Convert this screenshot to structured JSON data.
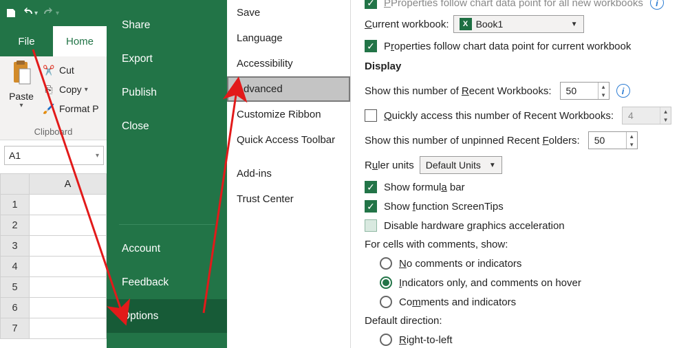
{
  "titlebar": {
    "undo_icon": "undo",
    "redo_icon": "redo",
    "save_icon": "save"
  },
  "tabs": {
    "file": "File",
    "home": "Home"
  },
  "ribbon": {
    "paste": "Paste",
    "cut": "Cut",
    "copy": "Copy",
    "format_painter": "Format P",
    "group_caption": "Clipboard"
  },
  "namebox": {
    "value": "A1"
  },
  "sheet": {
    "colA": "A",
    "rows": [
      "1",
      "2",
      "3",
      "4",
      "5",
      "6",
      "7"
    ]
  },
  "backstage": {
    "share": "Share",
    "export": "Export",
    "publish": "Publish",
    "close": "Close",
    "account": "Account",
    "feedback": "Feedback",
    "options": "Options"
  },
  "optnav": {
    "save": "Save",
    "language": "Language",
    "accessibility": "Accessibility",
    "advanced": "Advanced",
    "customize_ribbon": "Customize Ribbon",
    "quick_access": "Quick Access Toolbar",
    "addins": "Add-ins",
    "trust_center": "Trust Center"
  },
  "pane": {
    "top_truncated": "Properties follow chart data point for all new workbooks",
    "current_workbook_label": "Current workbook:",
    "current_workbook_value": "Book1",
    "prop_follow_current": "Properties follow chart data point for current workbook",
    "display_heading": "Display",
    "recent_wb_label": "Show this number of Recent Workbooks:",
    "recent_wb_value": "50",
    "quick_access_recent": "Quickly access this number of Recent Workbooks:",
    "quick_access_recent_value": "4",
    "recent_folders_label": "Show this number of unpinned Recent Folders:",
    "recent_folders_value": "50",
    "ruler_label": "Ruler units",
    "ruler_value": "Default Units",
    "show_formula_bar": "Show formula bar",
    "show_screentips": "Show function ScreenTips",
    "disable_hw": "Disable hardware graphics acceleration",
    "comments_heading": "For cells with comments, show:",
    "comments_none": "No comments or indicators",
    "comments_hover": "Indicators only, and comments on hover",
    "comments_both": "Comments and indicators",
    "direction_heading": "Default direction:",
    "direction_rtl": "Right-to-left"
  }
}
